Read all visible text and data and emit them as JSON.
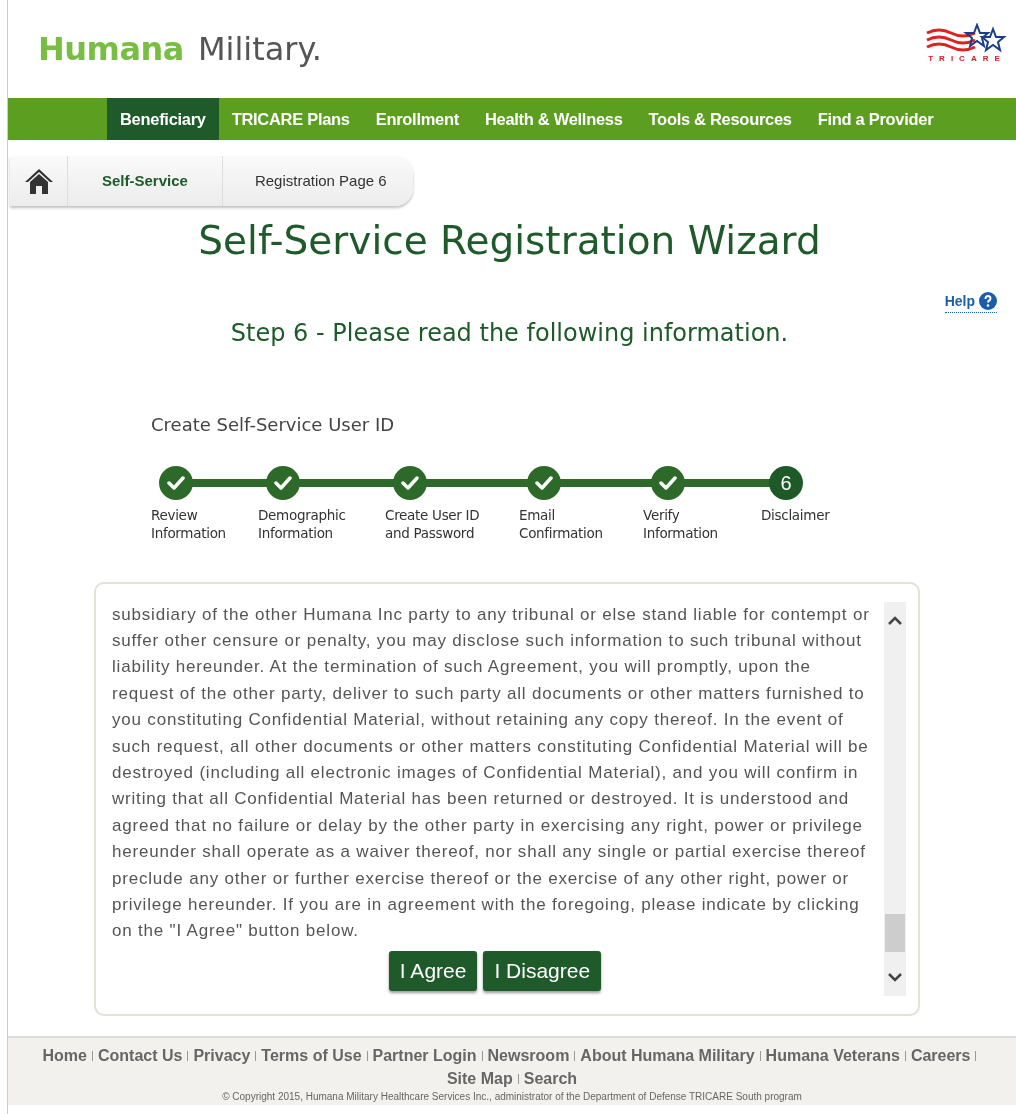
{
  "header": {
    "brand_primary": "Humana",
    "brand_secondary": "Military.",
    "partner_logo_text": "TRICARE"
  },
  "nav": [
    {
      "label": "Beneficiary",
      "selected": true
    },
    {
      "label": "TRICARE Plans",
      "selected": false
    },
    {
      "label": "Enrollment",
      "selected": false
    },
    {
      "label": "Health & Wellness",
      "selected": false
    },
    {
      "label": "Tools & Resources",
      "selected": false
    },
    {
      "label": "Find a Provider",
      "selected": false
    }
  ],
  "breadcrumb": [
    "Self-Service",
    "Registration Page 6"
  ],
  "title": "Self-Service Registration Wizard",
  "help_link": "Help",
  "step_heading": "Step 6 - Please read the following information.",
  "wizard": {
    "title": "Create Self-Service User ID",
    "steps": [
      {
        "label": "Review Information",
        "completed": true
      },
      {
        "label": "Demographic Information",
        "completed": true
      },
      {
        "label": "Create User ID and Password",
        "completed": true
      },
      {
        "label": "Email Confirmation",
        "completed": true
      },
      {
        "label": "Verify Information",
        "completed": true
      },
      {
        "label": "Disclaimer",
        "completed": false,
        "number": "6"
      }
    ]
  },
  "disclaimer": {
    "text": "subsidiary of the other Humana Inc party to any tribunal or else stand liable for contempt or suffer other censure or penalty, you may disclose such information to such tribunal without liability hereunder. At the termination of such Agreement, you will promptly, upon the request of the other party, deliver to such party all documents or other matters furnished to you constituting Confidential Material, without retaining any copy thereof. In the event of such request, all other documents or other matters constituting Confidential Material will be destroyed (including all electronic images of Confidential Material), and you will confirm in writing that all Confidential Material has been returned or destroyed. It is understood and agreed that no failure or delay by the other party in exercising any right, power or privilege hereunder shall operate as a waiver thereof, nor shall any single or partial exercise thereof preclude any other or further exercise thereof or the exercise of any other right, power or privilege hereunder. If you are in agreement with the foregoing, please indicate by clicking on the \"I Agree\" button below.",
    "buttons": [
      "I Agree",
      "I Disagree"
    ]
  },
  "footer": {
    "links": [
      "Home",
      "Contact Us",
      "Privacy",
      "Terms of Use",
      "Partner Login",
      "Newsroom",
      "About Humana Military",
      "Humana Veterans",
      "Careers",
      "Site Map",
      "Search"
    ],
    "copyright": "© Copyright 2015, Humana Military Healthcare Services Inc., administrator of the Department of Defense TRICARE South program"
  }
}
